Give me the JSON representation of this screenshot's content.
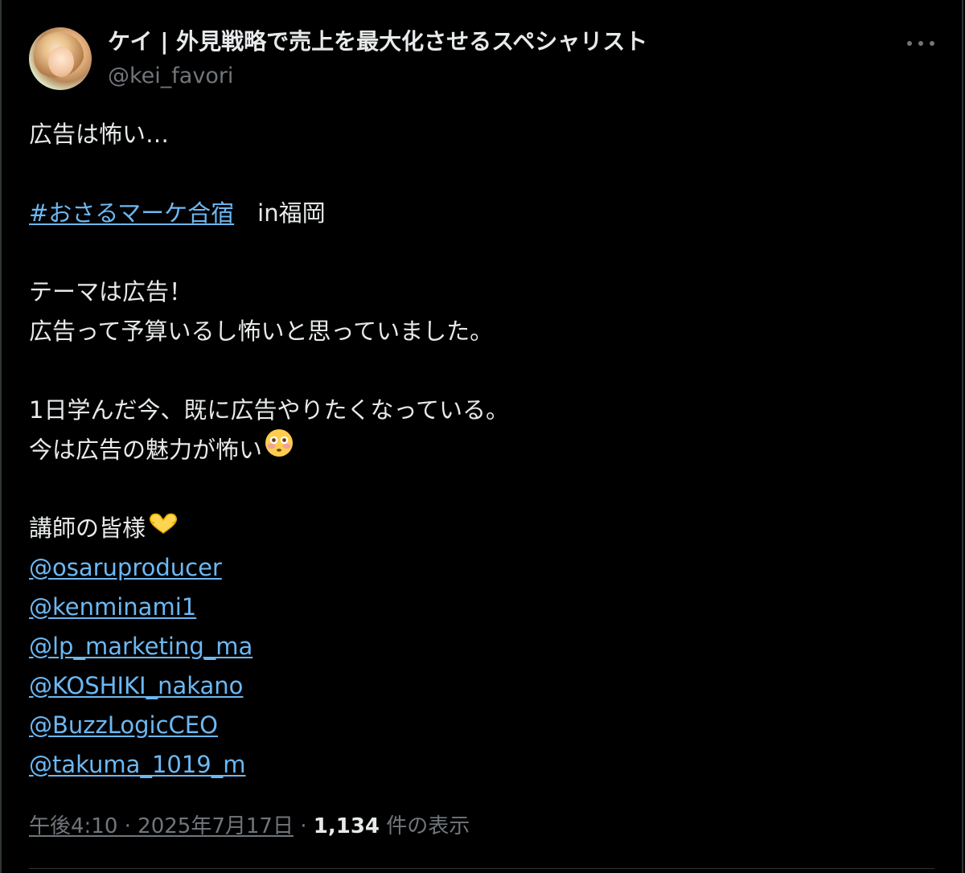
{
  "author": {
    "display_name": "ケイ | 外見戦略で売上を最大化させるスペシャリスト",
    "handle": "@kei_favori",
    "avatar_icon": "avatar-photo"
  },
  "tweet": {
    "line1": "広告は怖い…",
    "hashtag": "#おさるマーケ合宿",
    "hashtag_suffix": "　in福岡",
    "line3": "テーマは広告！",
    "line4": "広告って予算いるし怖いと思っていました。",
    "line5": "1日学んだ今、既に広告やりたくなっている。",
    "line6": "今は広告の魅力が怖い",
    "line6_emoji": "flushed-face-emoji",
    "line7": "講師の皆様",
    "line7_emoji": "heart-hands-emoji",
    "mentions": [
      " @osaruproducer",
      "@kenminami1",
      "@lp_marketing_ma",
      "@KOSHIKI_nakano",
      "@BuzzLogicCEO",
      "@takuma_1019_m"
    ]
  },
  "footer": {
    "timestamp": "午後4:10 · 2025年7月17日",
    "separator": " · ",
    "views_count": "1,134",
    "views_label": " 件の表示"
  },
  "colors": {
    "background": "#000000",
    "text": "#e7e9ea",
    "secondary": "#71767b",
    "link": "#6cb8f3",
    "border": "#2f3336"
  }
}
